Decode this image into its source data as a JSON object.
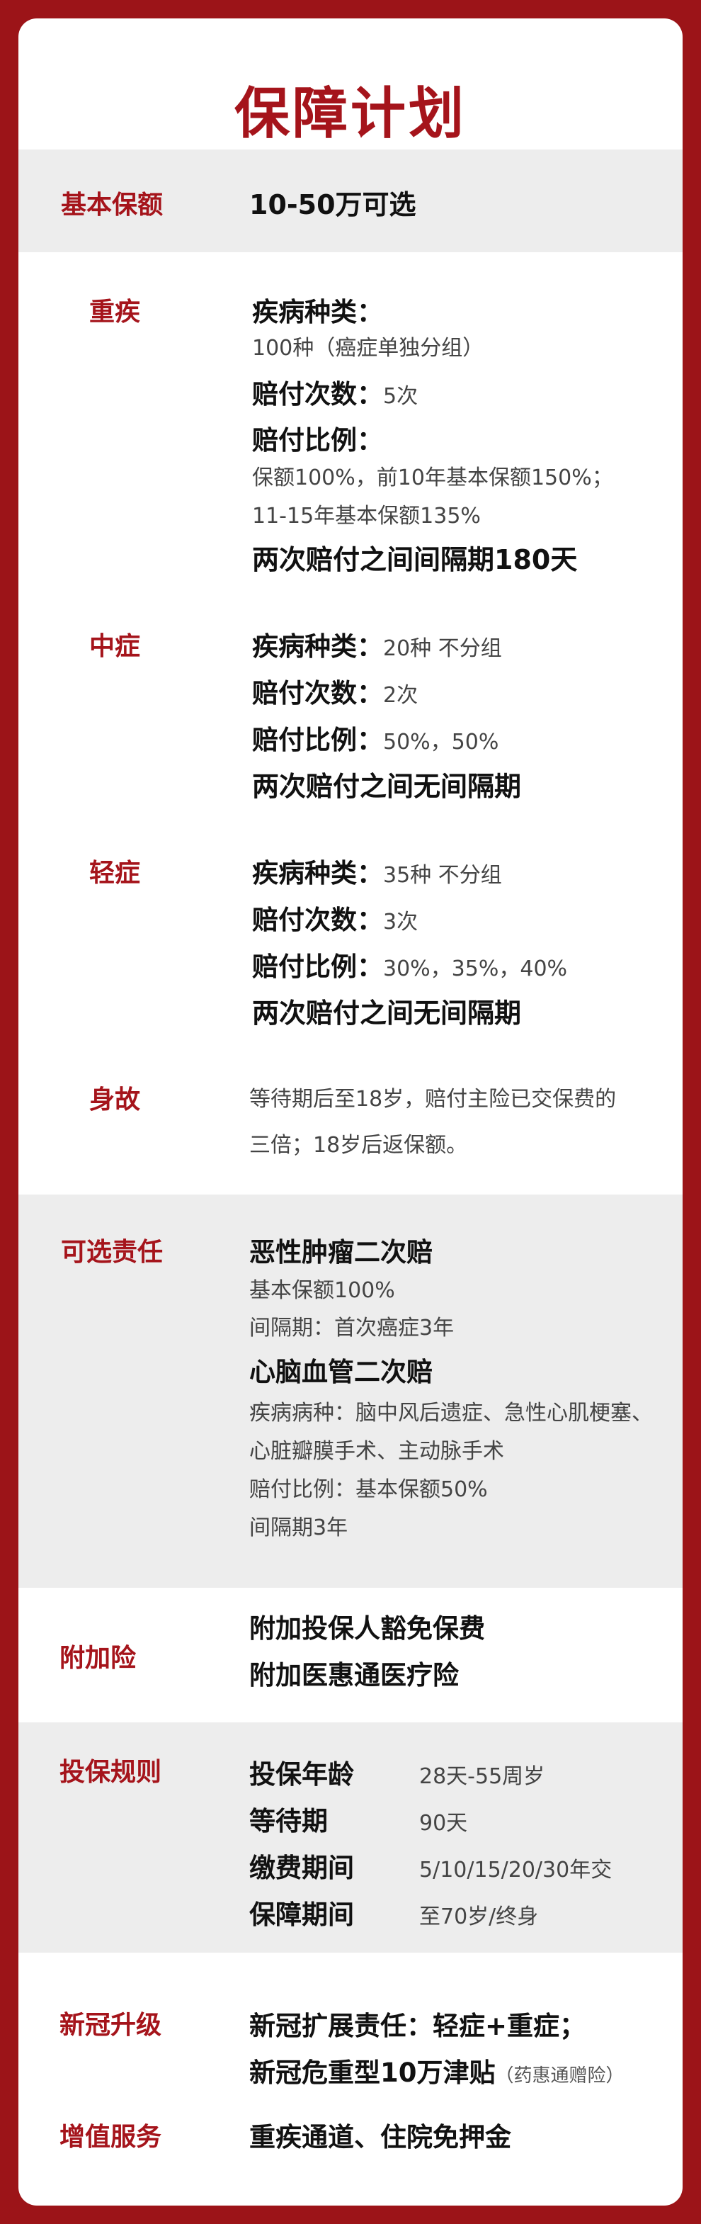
{
  "title": "保障计划",
  "basic": {
    "label": "基本保额",
    "value": "10-50万可选"
  },
  "critical": {
    "label": "重疾",
    "types_key": "疾病种类：",
    "types_value": "100种（癌症单独分组）",
    "times_key": "赔付次数：",
    "times_value": "5次",
    "ratio_key": "赔付比例：",
    "ratio_line1": "保额100%，前10年基本保额150%；",
    "ratio_line2": "11-15年基本保额135%",
    "interval": "两次赔付之间间隔期180天"
  },
  "moderate": {
    "label": "中症",
    "types_key": "疾病种类：",
    "types_value": "20种 不分组",
    "times_key": "赔付次数：",
    "times_value": "2次",
    "ratio_key": "赔付比例：",
    "ratio_value": "50%，50%",
    "interval": "两次赔付之间无间隔期"
  },
  "mild": {
    "label": "轻症",
    "types_key": "疾病种类：",
    "types_value": "35种 不分组",
    "times_key": "赔付次数：",
    "times_value": "3次",
    "ratio_key": "赔付比例：",
    "ratio_value": "30%，35%，40%",
    "interval": "两次赔付之间无间隔期"
  },
  "death": {
    "label": "身故",
    "line1": "等待期后至18岁，赔付主险已交保费的",
    "line2": "三倍；18岁后返保额。"
  },
  "optional": {
    "label": "可选责任",
    "h1": "恶性肿瘤二次赔",
    "h1_l1": "基本保额100%",
    "h1_l2": "间隔期：首次癌症3年",
    "h2": "心脑血管二次赔",
    "h2_l1": "疾病病种：脑中风后遗症、急性心肌梗塞、",
    "h2_l2": "心脏瓣膜手术、主动脉手术",
    "h2_l3": "赔付比例：基本保额50%",
    "h2_l4": "间隔期3年"
  },
  "addon": {
    "label": "附加险",
    "line1": "附加投保人豁免保费",
    "line2": "附加医惠通医疗险"
  },
  "rules": {
    "label": "投保规则",
    "rows": [
      {
        "k": "投保年龄",
        "v": "28天-55周岁"
      },
      {
        "k": "等待期",
        "v": "90天"
      },
      {
        "k": "缴费期间",
        "v": "5/10/15/20/30年交"
      },
      {
        "k": "保障期间",
        "v": "至70岁/终身"
      }
    ]
  },
  "covid": {
    "label": "新冠升级",
    "line1": "新冠扩展责任：轻症+重症；",
    "line2": "新冠危重型10万津贴",
    "line2_note": "（药惠通赠险）"
  },
  "service": {
    "label": "增值服务",
    "value": "重疾通道、住院免押金"
  }
}
